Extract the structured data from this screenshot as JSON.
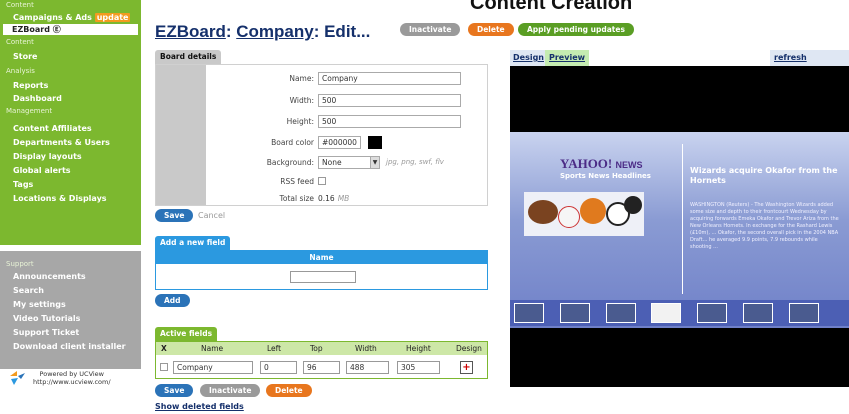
{
  "banner": "Content Creation",
  "sidebar": {
    "sections": [
      {
        "title": "Content",
        "items": [
          {
            "label": "Campaigns & Ads",
            "badge": "update"
          },
          {
            "label": "EZBoard Ⓔ",
            "active": true
          }
        ]
      },
      {
        "title": "Content",
        "items": [
          {
            "label": "Store"
          }
        ]
      },
      {
        "title": "Analysis",
        "items": [
          {
            "label": "Reports"
          },
          {
            "label": "Dashboard"
          }
        ]
      },
      {
        "title": "Management",
        "items": [
          {
            "label": "Content Affiliates"
          },
          {
            "label": "Departments & Users"
          },
          {
            "label": "Display layouts"
          },
          {
            "label": "Global alerts"
          },
          {
            "label": "Tags"
          },
          {
            "label": "Locations & Displays"
          }
        ]
      }
    ],
    "support": {
      "title": "Support",
      "items": [
        "Announcements",
        "Search",
        "My settings",
        "Video Tutorials",
        "Support Ticket",
        "Download client installer"
      ]
    },
    "powered_by": "Powered by UCView",
    "powered_url": "http://www.ucview.com/"
  },
  "header": {
    "title_prefix": "EZBoard",
    "title_mid": "Company",
    "title_suffix": "Edit...",
    "inactivate": "Inactivate",
    "delete": "Delete",
    "apply": "Apply pending updates"
  },
  "board_details": {
    "tab": "Board details",
    "name_label": "Name:",
    "name": "Company",
    "width_label": "Width:",
    "width": "500",
    "height_label": "Height:",
    "height": "500",
    "color_label": "Board color",
    "color": "#000000",
    "bg_label": "Background:",
    "bg": "None",
    "bg_hint": "jpg, png, swf, flv",
    "rss_label": "RSS feed",
    "size_label": "Total size",
    "size": "0.16",
    "size_unit": "MB",
    "save": "Save",
    "cancel": "Cancel"
  },
  "add_field": {
    "tab": "Add a new field",
    "col": "Name",
    "add": "Add"
  },
  "active_fields": {
    "tab": "Active fields",
    "cols": {
      "x": "X",
      "name": "Name",
      "left": "Left",
      "top": "Top",
      "width": "Width",
      "height": "Height",
      "design": "Design"
    },
    "row": {
      "name": "Company",
      "left": "0",
      "top": "96",
      "width": "488",
      "height": "305"
    },
    "save": "Save",
    "inactivate": "Inactivate",
    "delete": "Delete",
    "show_deleted": "Show deleted fields"
  },
  "preview": {
    "design_tab": "Design",
    "preview_tab": "Preview",
    "refresh": "refresh preview",
    "yahoo": "YAHOO!",
    "news": "NEWS",
    "subtitle": "Sports News Headlines",
    "headline": "Wizards acquire Okafor from the Hornets",
    "story": "WASHINGTON (Reuters) - The Washington Wizards added some size and depth to their frontcourt Wednesday by acquiring forwards Emeka Okafor and Trevor Ariza from the New Orleans Hornets. In exchange for the Rashard Lewis (£10m), ... Okafor, the second overall pick in the 2004 NBA Draft... he averaged 9.9 points, 7.9 rebounds while shooting ..."
  }
}
